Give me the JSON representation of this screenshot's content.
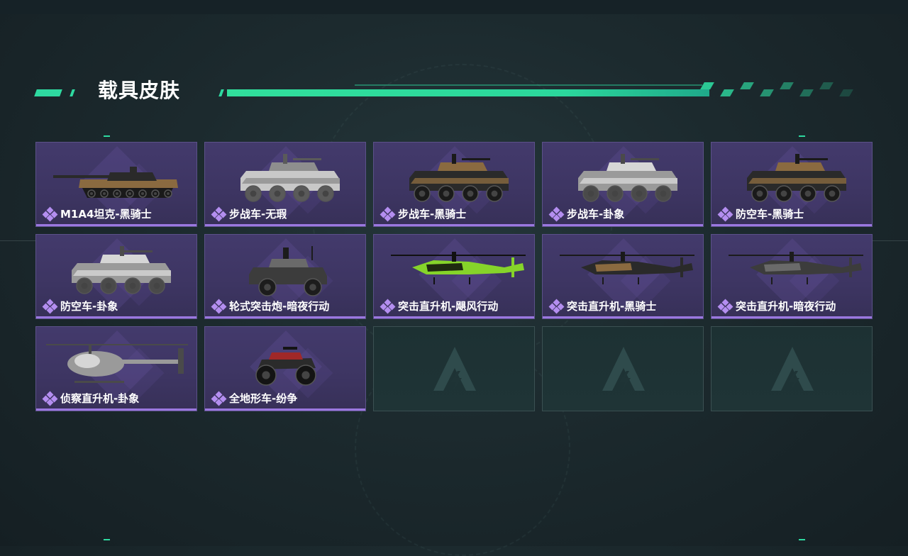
{
  "section": {
    "title": "载具皮肤"
  },
  "colors": {
    "accent": "#2ed9a0",
    "card_bg": "#3f3766",
    "rarity": "#b48ef0"
  },
  "skins": [
    {
      "name": "M1A4坦克-黑骑士",
      "icon": "tank-icon",
      "camo": "black-gold"
    },
    {
      "name": "步战车-无瑕",
      "icon": "ifv-icon",
      "camo": "white-grey"
    },
    {
      "name": "步战车-黑骑士",
      "icon": "ifv-icon",
      "camo": "black-gold"
    },
    {
      "name": "步战车-卦象",
      "icon": "ifv-icon",
      "camo": "grey-white"
    },
    {
      "name": "防空车-黑骑士",
      "icon": "aa-vehicle-icon",
      "camo": "black-gold"
    },
    {
      "name": "防空车-卦象",
      "icon": "aa-vehicle-icon",
      "camo": "grey-white"
    },
    {
      "name": "轮式突击炮-暗夜行动",
      "icon": "assault-gun-icon",
      "camo": "dark-grey"
    },
    {
      "name": "突击直升机-飓风行动",
      "icon": "attack-helicopter-icon",
      "camo": "green-black"
    },
    {
      "name": "突击直升机-黑骑士",
      "icon": "attack-helicopter-icon",
      "camo": "black-gold"
    },
    {
      "name": "突击直升机-暗夜行动",
      "icon": "attack-helicopter-icon",
      "camo": "dark-grey"
    },
    {
      "name": "侦察直升机-卦象",
      "icon": "scout-helicopter-icon",
      "camo": "grey-white"
    },
    {
      "name": "全地形车-纷争",
      "icon": "atv-icon",
      "camo": "black-red"
    }
  ],
  "empty_slots": 3
}
